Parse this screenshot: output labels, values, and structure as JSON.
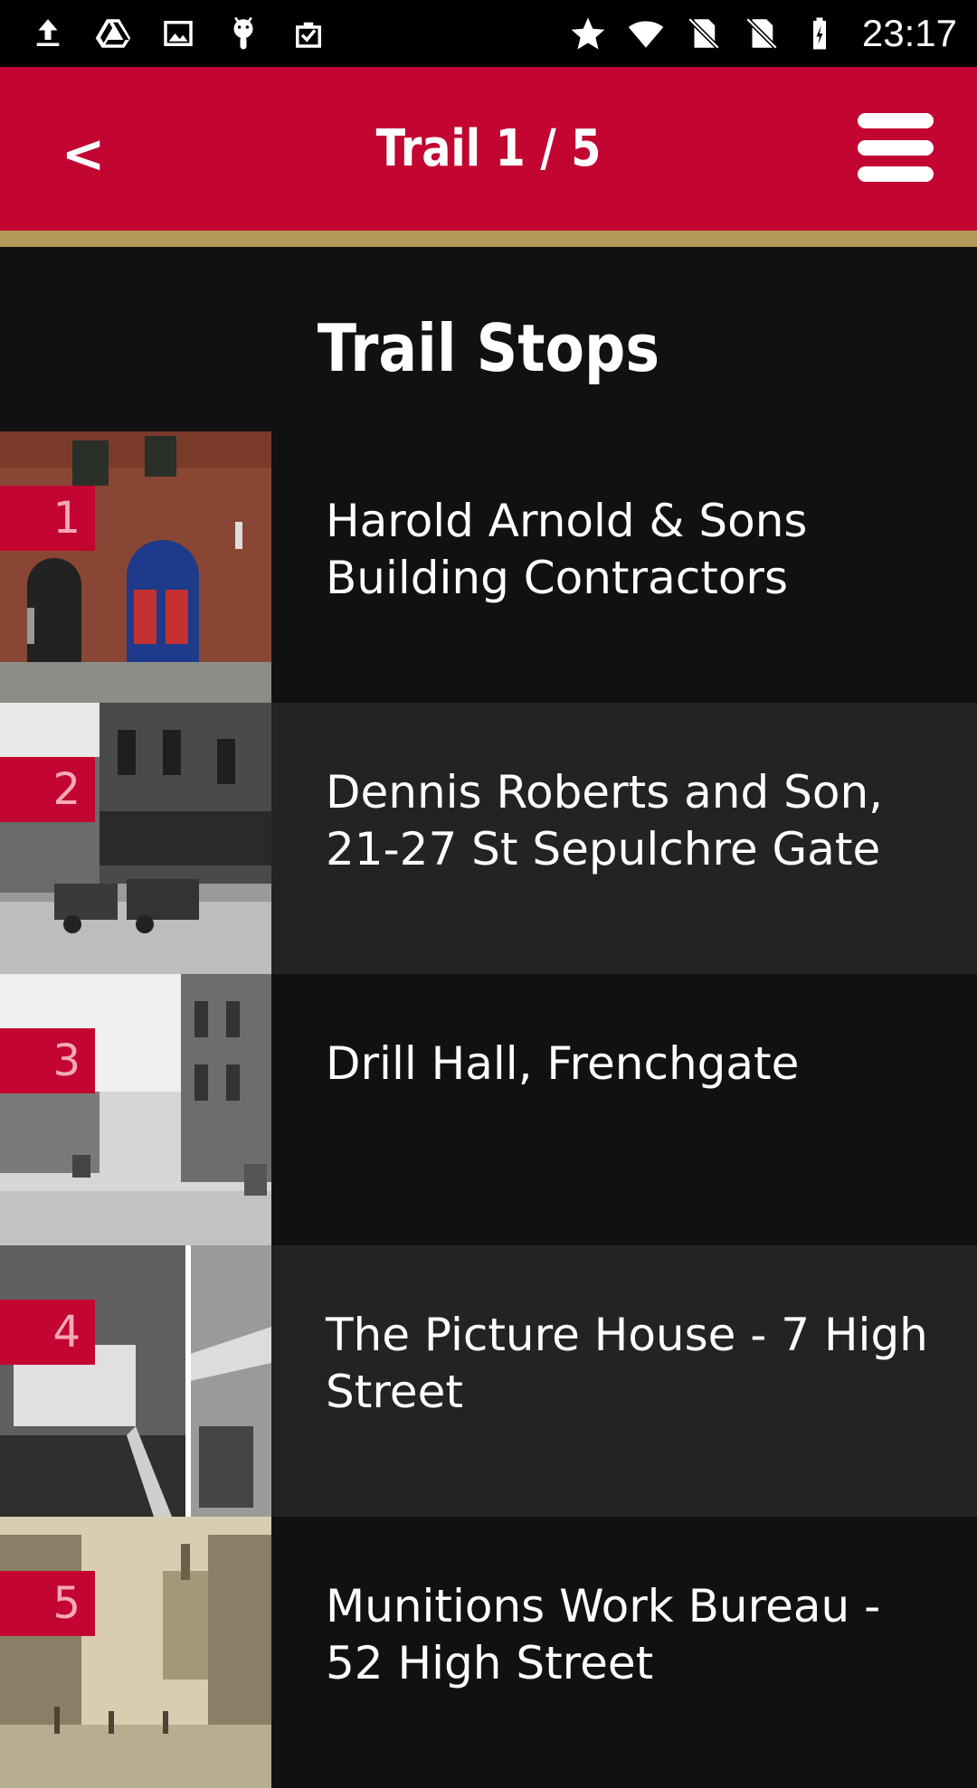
{
  "status_bar": {
    "time": "23:17",
    "left_icons": [
      "upload-icon",
      "drive-icon",
      "image-icon",
      "android-icon",
      "clipboard-check-icon"
    ],
    "right_icons": [
      "star-icon",
      "wifi-icon",
      "no-sim-icon",
      "no-sim-icon",
      "battery-charging-icon"
    ]
  },
  "app_bar": {
    "back_label": "<",
    "title": "Trail 1 / 5",
    "menu_icon": "hamburger-menu-icon",
    "accent_color": "#c20631",
    "stripe_color": "#b39a5a"
  },
  "section": {
    "title": "Trail Stops"
  },
  "stops": [
    {
      "number": "1",
      "title": "Harold Arnold & Sons Building Contractors"
    },
    {
      "number": "2",
      "title": "Dennis Roberts and Son, 21-27 St Sepulchre Gate"
    },
    {
      "number": "3",
      "title": "Drill Hall, Frenchgate"
    },
    {
      "number": "4",
      "title": "The Picture House - 7 High Street"
    },
    {
      "number": "5",
      "title": "Munitions Work Bureau - 52 High Street"
    }
  ]
}
